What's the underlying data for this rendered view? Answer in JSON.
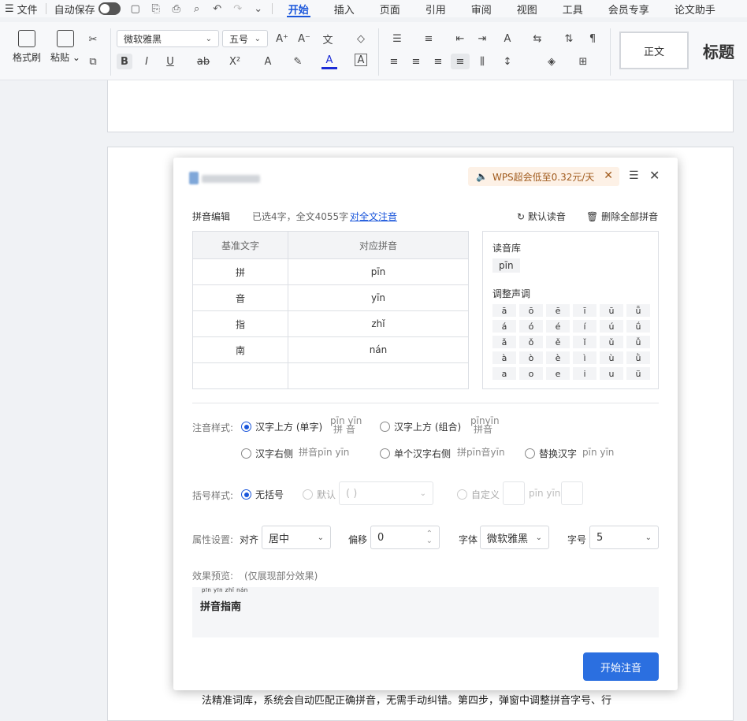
{
  "menubar": {
    "file": "文件",
    "autosave": "自动保存",
    "tabs": [
      "开始",
      "插入",
      "页面",
      "引用",
      "审阅",
      "视图",
      "工具",
      "会员专享",
      "论文助手"
    ]
  },
  "ribbon": {
    "format_painter": "格式刷",
    "paste": "粘贴",
    "font_name": "微软雅黑",
    "font_size": "五号",
    "style_normal": "正文",
    "style_heading": "标题"
  },
  "document": {
    "bottom_text": "法精准词库，系统会自动匹配正确拼音，无需手动纠错。第四步，弹窗中调整拼音字号、行"
  },
  "dialog": {
    "promo": "WPS超会低至0.32元/天",
    "editor_title": "拼音编辑",
    "selected_info": "已选4字，全文4055字",
    "full_text_link": "对全文注音",
    "default_reading": "默认读音",
    "delete_all": "删除全部拼音",
    "table": {
      "headers": [
        "基准文字",
        "对应拼音"
      ],
      "rows": [
        {
          "char": "拼",
          "pinyin": "pīn"
        },
        {
          "char": "音",
          "pinyin": "yīn"
        },
        {
          "char": "指",
          "pinyin": "zhǐ"
        },
        {
          "char": "南",
          "pinyin": "nán"
        },
        {
          "char": "",
          "pinyin": ""
        }
      ]
    },
    "library_title": "读音库",
    "library_chip": "pīn",
    "tone_title": "调整声调",
    "tones": [
      [
        "ā",
        "ō",
        "ē",
        "ī",
        "ū",
        "ǖ"
      ],
      [
        "á",
        "ó",
        "é",
        "í",
        "ú",
        "ǘ"
      ],
      [
        "ǎ",
        "ǒ",
        "ě",
        "ǐ",
        "ǔ",
        "ǚ"
      ],
      [
        "à",
        "ò",
        "è",
        "ì",
        "ù",
        "ǜ"
      ],
      [
        "a",
        "o",
        "e",
        "i",
        "u",
        "ü"
      ]
    ],
    "annotation_style_label": "注音样式:",
    "opt_above_single": "汉字上方 (单字)",
    "sample_above_single_py": "pīn yīn",
    "sample_above_single_hz": "拼 音",
    "opt_above_group": "汉字上方 (组合)",
    "sample_above_group_py": "pīnyīn",
    "sample_above_group_hz": "拼音",
    "opt_right": "汉字右侧",
    "sample_right": "拼音pīn yīn",
    "opt_each_right": "单个汉字右侧",
    "sample_each_right": "拼pīn音yīn",
    "opt_replace": "替换汉字",
    "sample_replace": "pīn yīn",
    "bracket_label": "括号样式:",
    "opt_no_bracket": "无括号",
    "opt_default": "默认",
    "default_bracket_value": "( )",
    "opt_custom": "自定义",
    "custom_sample": "pīn yīn",
    "property_label": "属性设置:",
    "align_label": "对齐",
    "align_value": "居中",
    "offset_label": "偏移",
    "offset_value": "0",
    "font_label": "字体",
    "font_value": "微软雅黑",
    "size_label": "字号",
    "size_value": "5",
    "preview_label": "效果预览:",
    "preview_note": "(仅展现部分效果)",
    "preview_ruby": "pīn yīn zhǐ nán",
    "preview_text": "拼音指南",
    "start_button": "开始注音"
  }
}
